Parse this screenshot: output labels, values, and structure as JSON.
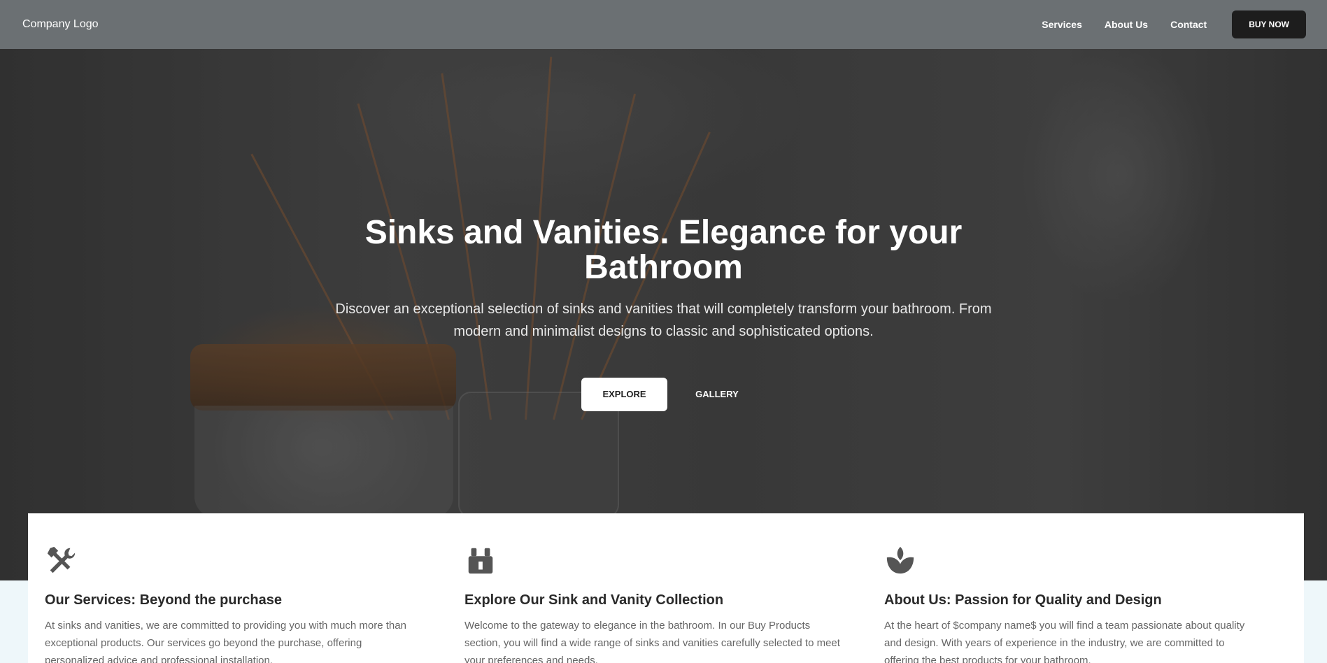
{
  "nav": {
    "logo": "Company Logo",
    "links": [
      "Services",
      "About Us",
      "Contact"
    ],
    "cta": "BUY NOW"
  },
  "hero": {
    "title": "Sinks and Vanities. Elegance for your Bathroom",
    "subtitle": "Discover an exceptional selection of sinks and vanities that will completely transform your bathroom. From modern and minimalist designs to classic and sophisticated options.",
    "primary_button": "EXPLORE",
    "secondary_button": "GALLERY"
  },
  "cards": [
    {
      "icon": "tools-icon",
      "title": "Our Services: Beyond the purchase",
      "text": "At sinks and vanities, we are committed to providing you with much more than exceptional products. Our services go beyond the purchase, offering personalized advice and professional installation."
    },
    {
      "icon": "gift-box-icon",
      "title": "Explore Our Sink and Vanity Collection",
      "text": "Welcome to the gateway to elegance in the bathroom. In our Buy Products section, you will find a wide range of sinks and vanities carefully selected to meet your preferences and needs."
    },
    {
      "icon": "lotus-icon",
      "title": "About Us: Passion for Quality and Design",
      "text": "At the heart of $company name$ you will find a team passionate about quality and design. With years of experience in the industry, we are committed to offering the best products for your bathroom."
    }
  ],
  "colors": {
    "navbar": "#6b7073",
    "buy_button": "#1d1d1d",
    "icon": "#555555"
  }
}
